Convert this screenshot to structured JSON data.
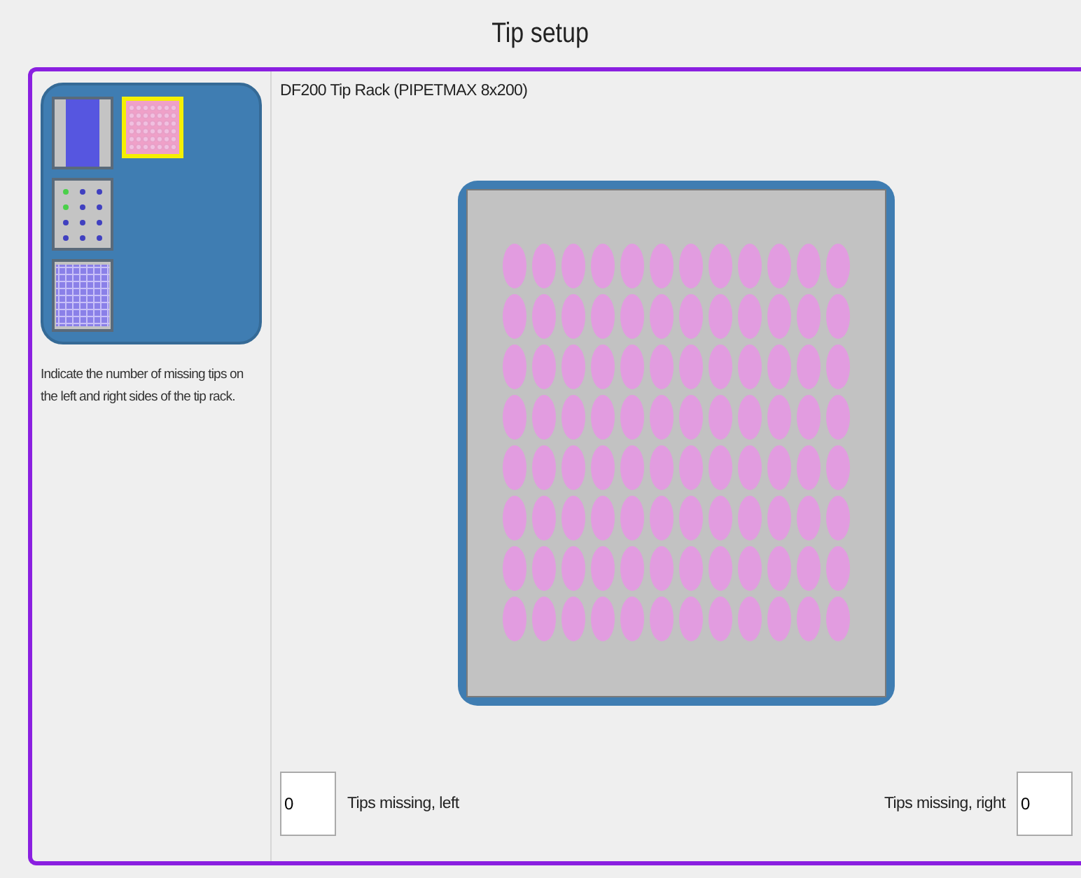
{
  "window": {
    "title": "Tip setup"
  },
  "rack_types": [
    {
      "kind": "reservoir",
      "selected": false
    },
    {
      "kind": "plate",
      "selected": true
    },
    {
      "kind": "sparse",
      "selected": false
    },
    {
      "kind": "dense",
      "selected": false
    }
  ],
  "instructions": "Indicate the number of missing tips on the left and right sides of the tip rack.",
  "rack": {
    "title": "DF200 Tip Rack (PIPETMAX 8x200)"
  },
  "fields": {
    "left": {
      "label": "Tips missing, left",
      "value": "0"
    },
    "right": {
      "label": "Tips missing, right",
      "value": "0"
    }
  }
}
